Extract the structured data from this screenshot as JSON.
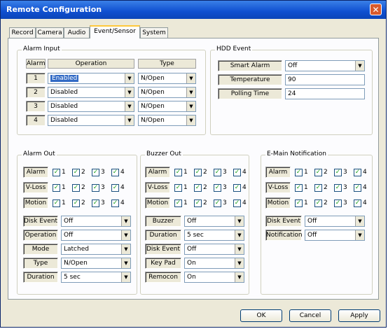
{
  "window": {
    "title": "Remote Configuration",
    "close_icon": "close-icon"
  },
  "tabs": [
    {
      "label": "Record"
    },
    {
      "label": "Camera"
    },
    {
      "label": "Audio"
    },
    {
      "label": "Event/Sensor",
      "active": true
    },
    {
      "label": "System"
    }
  ],
  "alarm_input": {
    "title": "Alarm Input",
    "headers": {
      "alarm": "Alarm",
      "operation": "Operation",
      "type": "Type"
    },
    "rows": [
      {
        "alarm": "1",
        "operation": "Enabled",
        "type": "N/Open"
      },
      {
        "alarm": "2",
        "operation": "Disabled",
        "type": "N/Open"
      },
      {
        "alarm": "3",
        "operation": "Disabled",
        "type": "N/Open"
      },
      {
        "alarm": "4",
        "operation": "Disabled",
        "type": "N/Open"
      }
    ]
  },
  "hdd_event": {
    "title": "HDD Event",
    "smart_alarm": {
      "label": "Smart Alarm",
      "value": "Off"
    },
    "temperature": {
      "label": "Temperature",
      "value": "90"
    },
    "polling_time": {
      "label": "Polling Time",
      "value": "24"
    }
  },
  "check_rows": {
    "alarm": "Alarm",
    "vloss": "V-Loss",
    "motion": "Motion",
    "numbers": [
      "1",
      "2",
      "3",
      "4"
    ]
  },
  "alarm_out": {
    "title": "Alarm Out",
    "disk_event": {
      "label": "Disk Event",
      "value": "Off"
    },
    "operation": {
      "label": "Operation",
      "value": "Off"
    },
    "mode": {
      "label": "Mode",
      "value": "Latched"
    },
    "type": {
      "label": "Type",
      "value": "N/Open"
    },
    "duration": {
      "label": "Duration",
      "value": "5 sec"
    }
  },
  "buzzer_out": {
    "title": "Buzzer Out",
    "buzzer": {
      "label": "Buzzer",
      "value": "Off"
    },
    "duration": {
      "label": "Duration",
      "value": "5 sec"
    },
    "disk_event": {
      "label": "Disk Event",
      "value": "Off"
    },
    "key_pad": {
      "label": "Key Pad",
      "value": "On"
    },
    "remocon": {
      "label": "Remocon",
      "value": "On"
    }
  },
  "email": {
    "title": "E-Main Notification",
    "disk_event": {
      "label": "Disk Event",
      "value": "Off"
    },
    "notification": {
      "label": "Notification",
      "value": "Off"
    }
  },
  "buttons": {
    "ok": "OK",
    "cancel": "Cancel",
    "apply": "Apply"
  },
  "check_mark": "✓",
  "dropdown_arrow": "▼"
}
